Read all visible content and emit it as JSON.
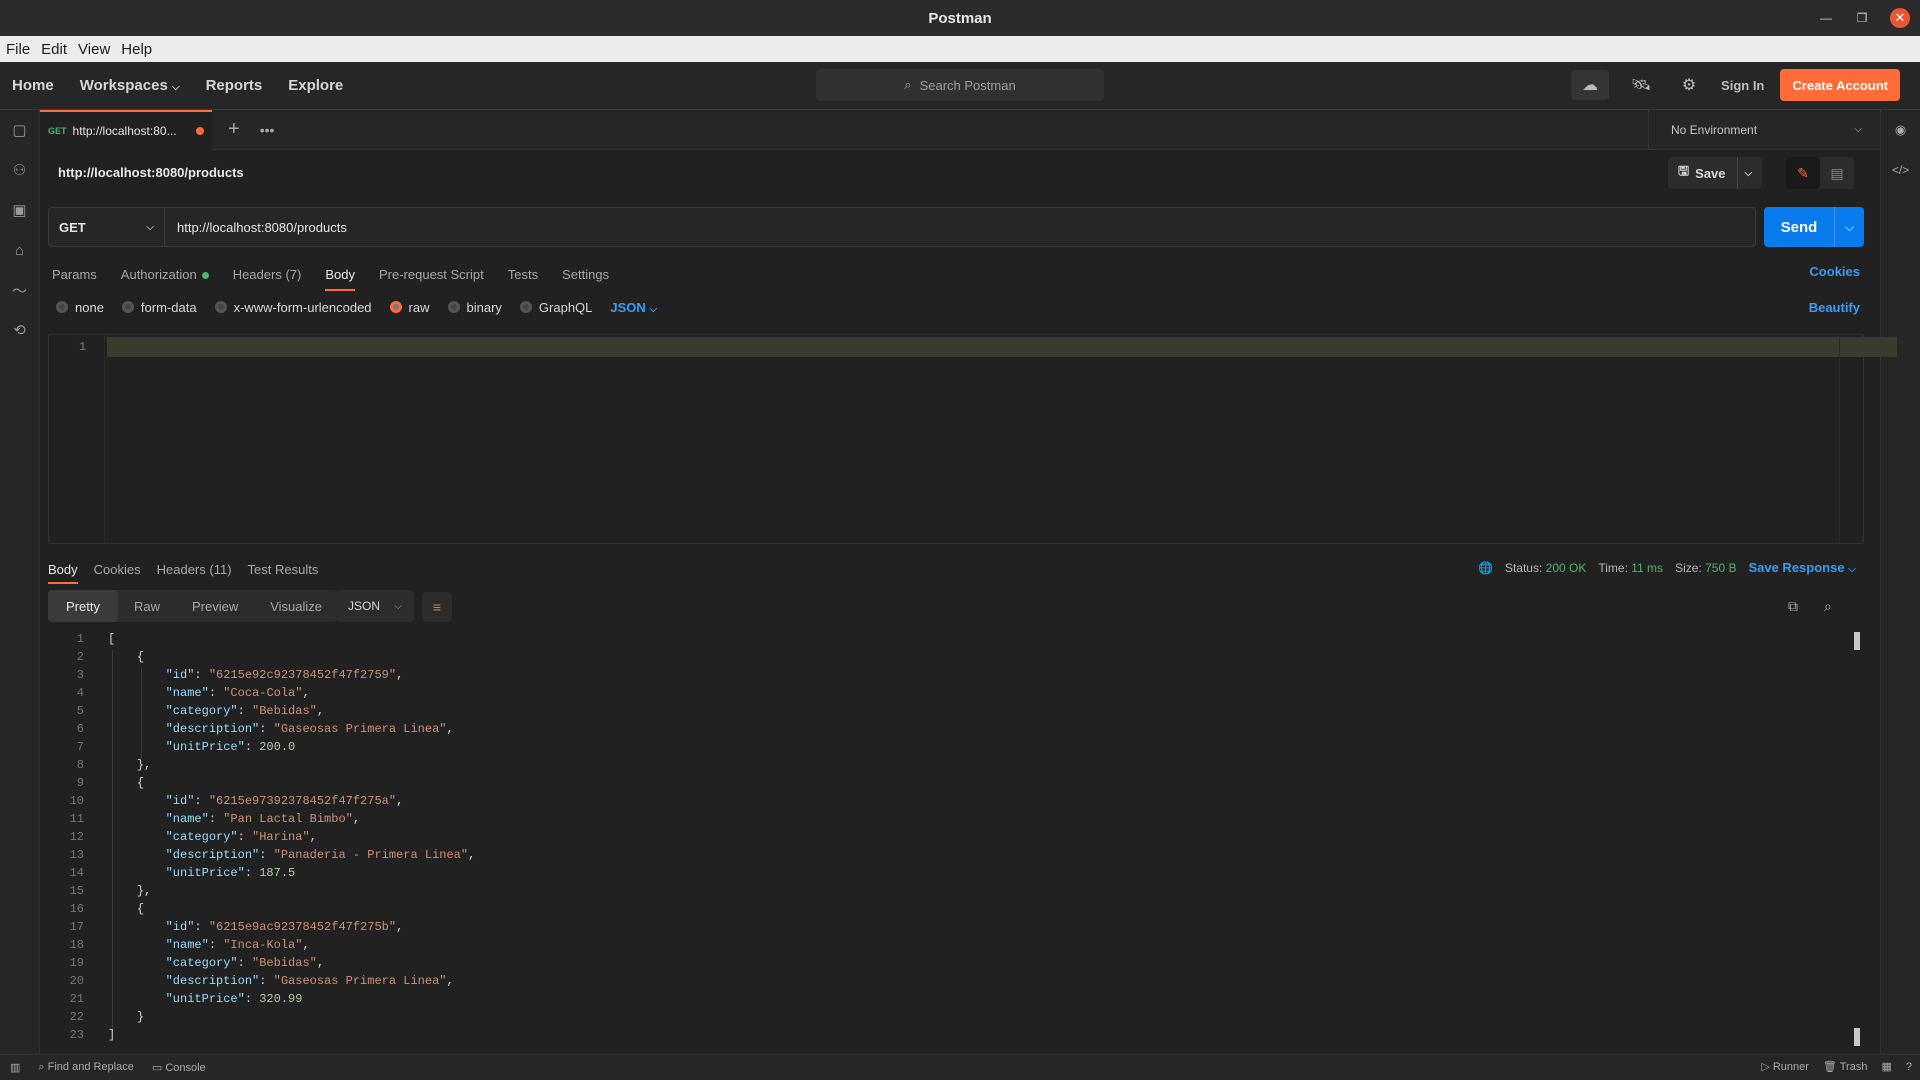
{
  "window": {
    "title": "Postman"
  },
  "menu": [
    "File",
    "Edit",
    "View",
    "Help"
  ],
  "topnav": {
    "home": "Home",
    "workspaces": "Workspaces",
    "reports": "Reports",
    "explore": "Explore",
    "search_placeholder": "Search Postman",
    "sign_in": "Sign In",
    "create_account": "Create Account"
  },
  "tab": {
    "method": "GET",
    "title": "http://localhost:80..."
  },
  "environment": "No Environment",
  "request": {
    "title": "http://localhost:8080/products",
    "save_label": "Save",
    "method": "GET",
    "url": "http://localhost:8080/products",
    "send_label": "Send"
  },
  "req_tabs": {
    "params": "Params",
    "authorization": "Authorization",
    "headers": "Headers",
    "headers_count": "(7)",
    "body": "Body",
    "prerequest": "Pre-request Script",
    "tests": "Tests",
    "settings": "Settings",
    "cookies": "Cookies"
  },
  "body_types": {
    "none": "none",
    "form_data": "form-data",
    "urlencoded": "x-www-form-urlencoded",
    "raw": "raw",
    "binary": "binary",
    "graphql": "GraphQL",
    "language": "JSON",
    "beautify": "Beautify",
    "editor_line": "1"
  },
  "response": {
    "tabs": {
      "body": "Body",
      "cookies": "Cookies",
      "headers": "Headers",
      "headers_count": "(11)",
      "test_results": "Test Results"
    },
    "status_label": "Status:",
    "status_value": "200 OK",
    "time_label": "Time:",
    "time_value": "11 ms",
    "size_label": "Size:",
    "size_value": "750 B",
    "save_response": "Save Response",
    "formats": {
      "pretty": "Pretty",
      "raw": "Raw",
      "preview": "Preview",
      "visualize": "Visualize"
    },
    "language": "JSON",
    "items": [
      {
        "id": "6215e92c92378452f47f2759",
        "name": "Coca-Cola",
        "category": "Bebidas",
        "description": "Gaseosas Primera Linea",
        "unitPrice": "200.0"
      },
      {
        "id": "6215e97392378452f47f275a",
        "name": "Pan Lactal Bimbo",
        "category": "Harina",
        "description": "Panaderia - Primera Linea",
        "unitPrice": "187.5"
      },
      {
        "id": "6215e9ac92378452f47f275b",
        "name": "Inca-Kola",
        "category": "Bebidas",
        "description": "Gaseosas Primera Linea",
        "unitPrice": "320.99"
      }
    ]
  },
  "footer": {
    "find_replace": "Find and Replace",
    "console": "Console",
    "runner": "Runner",
    "trash": "Trash"
  }
}
